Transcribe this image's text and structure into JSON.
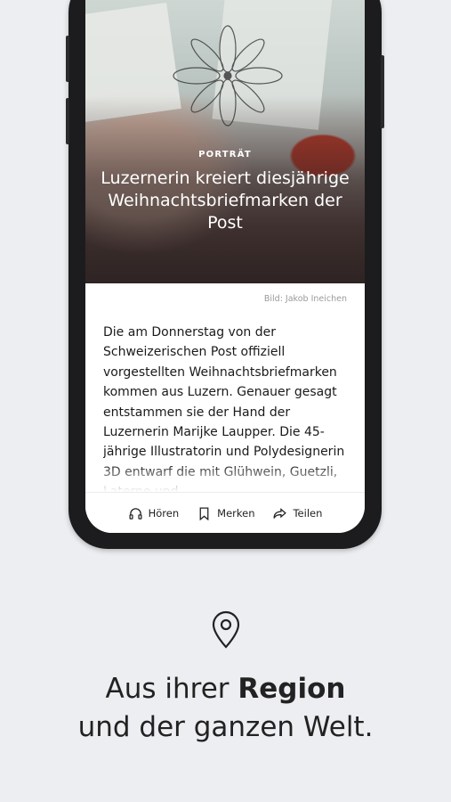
{
  "article": {
    "category": "PORTRÄT",
    "headline": "Luzernerin kreiert diesjährige Weihnachtsbriefmarken der Post",
    "image_credit": "Bild: Jakob Ineichen",
    "body": "Die am Donnerstag von der Schweizerischen Post offiziell vorgestellten Weihnachtsbriefmarken kommen aus Luzern. Genauer gesagt entstammen sie der Hand der Luzernerin Marijke Laupper. Die 45-jährige Illustratorin und Polydesignerin 3D entwarf die mit Glühwein, Guetzli, Laterne und"
  },
  "toolbar": {
    "listen_label": "Hören",
    "bookmark_label": "Merken",
    "share_label": "Teilen"
  },
  "promo": {
    "line1_prefix": "Aus ihrer ",
    "line1_bold": "Region",
    "line2": "und der ganzen Welt."
  },
  "colors": {
    "background": "#eceef1",
    "phone_frame": "#1c1c1e",
    "text": "#222222"
  },
  "icons": [
    "headphones-icon",
    "bookmark-icon",
    "share-icon",
    "location-pin-icon"
  ]
}
